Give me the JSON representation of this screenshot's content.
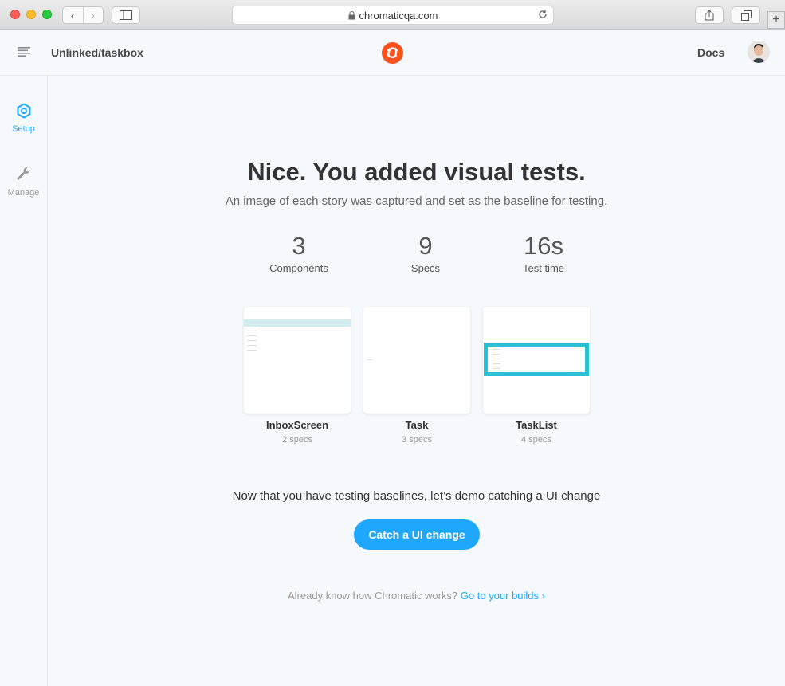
{
  "browser": {
    "url": "chromaticqa.com"
  },
  "header": {
    "project": "Unlinked/taskbox",
    "docs_label": "Docs"
  },
  "sidebar": {
    "items": [
      {
        "label": "Setup",
        "icon": "setup-icon",
        "active": true
      },
      {
        "label": "Manage",
        "icon": "wrench-icon",
        "active": false
      }
    ]
  },
  "main": {
    "headline": "Nice. You added visual tests.",
    "subline": "An image of each story was captured and set as the baseline for testing.",
    "stats": [
      {
        "value": "3",
        "label": "Components"
      },
      {
        "value": "9",
        "label": "Specs"
      },
      {
        "value": "16s",
        "label": "Test time"
      }
    ],
    "components": [
      {
        "name": "InboxScreen",
        "specs": "2 specs"
      },
      {
        "name": "Task",
        "specs": "3 specs"
      },
      {
        "name": "TaskList",
        "specs": "4 specs"
      }
    ],
    "prompt": "Now that you have testing baselines, let’s demo catching a UI change",
    "cta_label": "Catch a UI change",
    "footer_text": "Already know how Chromatic works?",
    "footer_link": "Go to your builds ›"
  },
  "colors": {
    "accent": "#1ea7fd",
    "brand": "#fc521f",
    "highlight": "#2bc0d6"
  }
}
